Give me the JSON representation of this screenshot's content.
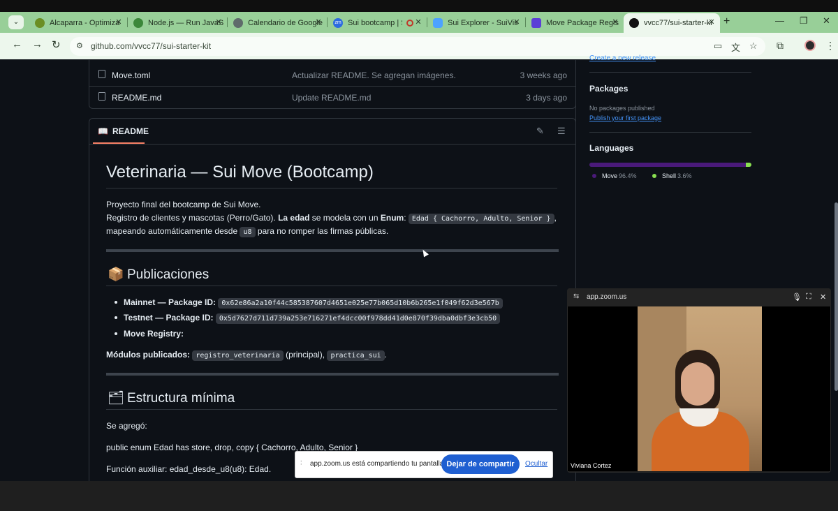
{
  "browser": {
    "tabs": [
      {
        "title": "Alcaparra - Optimiza",
        "favicon_color": "#6b8e23"
      },
      {
        "title": "Node.js — Run JavaS",
        "favicon_color": "#3c873a"
      },
      {
        "title": "Calendario de Google",
        "favicon_color": "#5f6b6b"
      },
      {
        "title": "Sui bootcamp | S",
        "favicon_color": "#2d6cdf",
        "favicon_text": "zm"
      },
      {
        "title": "Sui Explorer - SuiVis",
        "favicon_color": "#4da2ff"
      },
      {
        "title": "Move Package Regis",
        "favicon_color": "#5b3fd6"
      },
      {
        "title": "vvcc77/sui-starter-ki",
        "favicon_color": "#111111"
      }
    ],
    "url": "github.com/vvcc77/sui-starter-kit"
  },
  "files": [
    {
      "name": "Move.toml",
      "message": "Actualizar README. Se agregan imágenes.",
      "date": "3 weeks ago"
    },
    {
      "name": "README.md",
      "message": "Update README.md",
      "date": "3 days ago"
    }
  ],
  "readme": {
    "tab_label": "README",
    "title": "Veterinaria — Sui Move (Bootcamp)",
    "intro_1": "Proyecto final del bootcamp de Sui Move.",
    "intro_2a": "Registro de clientes y mascotas (Perro/Gato). ",
    "intro_2b": "La edad",
    "intro_2c": " se modela con un ",
    "intro_2d": "Enum",
    "intro_2e": ": ",
    "enum_code": "Edad { Cachorro, Adulto, Senior }",
    "intro_2f": ",",
    "intro_3a": "mapeando automáticamente desde ",
    "u8_code": "u8",
    "intro_3b": " para no romper las firmas públicas.",
    "publicaciones": {
      "heading": "Publicaciones",
      "mainnet_label": "Mainnet — Package ID:",
      "mainnet_id": "0x62e86a2a10f44c585387607d4651e025e77b065d10b6b265e1f049f62d3e567b",
      "testnet_label": "Testnet — Package ID:",
      "testnet_id": "0x5d7627d711d739a253e716271ef4dcc00f978dd41d0e870f39dba0dbf3e3cb50",
      "registry_label": "Move Registry:",
      "modules_label": "Módulos publicados:",
      "module_1": "registro_veterinaria",
      "module_1_note": " (principal), ",
      "module_2": "practica_sui",
      "modules_end": "."
    },
    "estructura": {
      "heading": "Estructura mínima",
      "line_1": "Se agregó:",
      "line_2": "public enum Edad has store, drop, copy { Cachorro, Adulto, Senior }",
      "line_3": "Función auxiliar: edad_desde_u8(u8): Edad."
    }
  },
  "sidebar": {
    "release_link": "Create a new release",
    "packages_heading": "Packages",
    "packages_text": "No packages published",
    "packages_link": "Publish your first package",
    "languages_heading": "Languages",
    "languages": [
      {
        "name": "Move",
        "percent": "96.4%",
        "value": 96.4,
        "color": "#4a1a7a"
      },
      {
        "name": "Shell",
        "percent": "3.6%",
        "value": 3.6,
        "color": "#89e051"
      }
    ]
  },
  "zoom": {
    "window_title": "app.zoom.us",
    "participant_name": "Viviana Cortez",
    "share_text": "app.zoom.us está compartiendo tu pantalla.",
    "stop_button": "Dejar de compartir",
    "hide_link": "Ocultar"
  }
}
